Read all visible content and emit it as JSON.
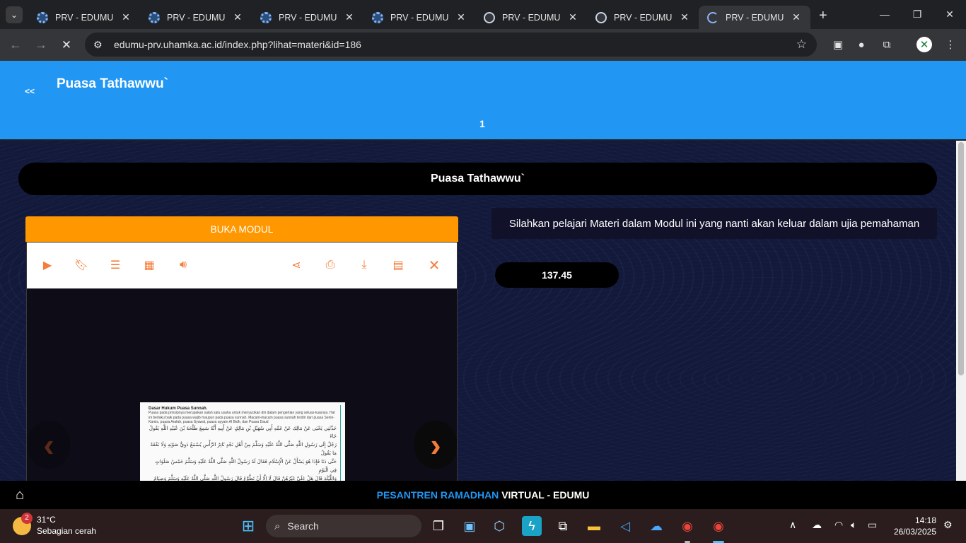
{
  "browser": {
    "tabs": [
      {
        "title": "PRV - EDUMU",
        "favicon": "gear-favicon"
      },
      {
        "title": "PRV - EDUMU",
        "favicon": "gear-favicon"
      },
      {
        "title": "PRV - EDUMU",
        "favicon": "gear-favicon"
      },
      {
        "title": "PRV - EDUMU",
        "favicon": "gear-favicon"
      },
      {
        "title": "PRV - EDUMU",
        "favicon": "globe-favicon"
      },
      {
        "title": "PRV - EDUMU",
        "favicon": "globe-favicon"
      },
      {
        "title": "PRV - EDUMU",
        "favicon": "loading-spinner",
        "active": true
      }
    ],
    "url": "edumu-prv.uhamka.ac.id/index.php?lihat=materi&id=186"
  },
  "header": {
    "back_label": "<<",
    "title": "Puasa Tathawwu`",
    "page_number": "1",
    "color": "#2196f3"
  },
  "content": {
    "section_title": "Puasa Tathawwu`",
    "open_module_label": "BUKA MODUL",
    "info_text": "Silahkan pelajari Materi dalam Modul ini yang nanti akan keluar dalam ujia pemahaman",
    "score": "137.45",
    "accent_color": "#ff9800",
    "viewer": {
      "toolbar_icons": [
        "play-icon",
        "bookmark-icon",
        "list-icon",
        "thumbnails-icon",
        "sound-icon",
        "share-icon",
        "print-icon",
        "download-icon",
        "document-icon",
        "close-icon"
      ],
      "doc_heading": "Dasar Hukum Puasa Sunnah.",
      "doc_text": "Puasa pada prinsipnya merupakan salah satu usaha untuk menyucikan diri dalam pengertian yang seluas-luasnya. Hal ini berlaku baik pada puasa wajib maupun pada puasa sunnah. Macam-macam puasa sunnah terdiri dari puasa Senin-Kamis, puasa Arafah, puasa Syawal, puasa ayyam Al Bidh, dan Puasa Daud",
      "doc_arabic_1": "حَدَّثَنِي يَحْيَى عَنْ مَالِك عَنْ عَمِّهِ أَبِي سُهَيْلٍ بْنِ مَالِكٍ عَنْ أَبِيهِ أَنَّهُ سَمِعَ طَلْحَةَ بْنَ عُبَيْدِ اللَّهِ يَقُولُ جَاءَ",
      "doc_arabic_2": "رَجُلٌ إِلَى رَسُولِ اللَّهِ صَلَّى اللَّهُ عَلَيْهِ وَسَلَّمَ مِنْ أَهْلِ نَجْدٍ ثَائِرُ الرَّأْسِ يُسْمَعُ دَوِيُّ صَوْتِهِ وَلَا نَفْقَهُ مَا يَقُولُ",
      "doc_arabic_3": "حَتَّى دَنَا فَإِذَا هُوَ يَسْأَلُ عَنْ الْإِسْلَامِ فَقَالَ لَهُ رَسُولُ اللَّهِ صَلَّى اللَّهُ عَلَيْهِ وَسَلَّمَ خَمْسُ صَلَوَاتٍ فِي الْيَوْمِ",
      "doc_arabic_4": "وَاللَّيْلَةِ قَالَ هَلْ عَلَيَّ غَيْرُهُنَّ قَالَ لَا إِلَّا أَنْ تَطَّوَّعَ قَالَ رَسُولُ اللَّهِ صَلَّى اللَّهُ عَلَيْهِ وَسَلَّمَ وَصِيَامُ شَهْرِ"
    }
  },
  "footer": {
    "brand_highlight": "PESANTREN RAMADHAN",
    "brand_rest": "VIRTUAL - EDUMU"
  },
  "taskbar": {
    "weather_temp": "31°C",
    "weather_desc": "Sebagian cerah",
    "weather_badge": "2",
    "search_label": "Search",
    "time": "14:18",
    "date": "26/03/2025"
  }
}
